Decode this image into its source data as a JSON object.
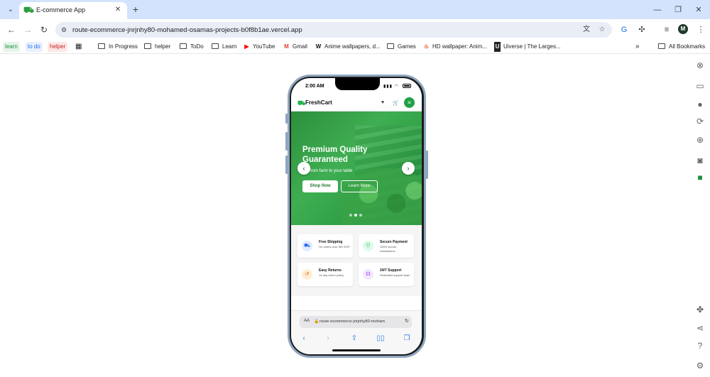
{
  "browser": {
    "tab": {
      "title": "E-commerce App",
      "icon": "freshcart-cart-icon"
    },
    "url": "route-ecommerce-jnrjnhy80-mohamed-osamas-projects-b0f8b1ae.vercel.app",
    "profile_initial": "M",
    "bookmarks": [
      {
        "label": "learn",
        "type": "badge",
        "color": "#1e8e3e",
        "bg": "#e6f4ea"
      },
      {
        "label": "to do",
        "type": "badge",
        "color": "#1a73e8",
        "bg": "#e8f0fe"
      },
      {
        "label": "helper",
        "type": "badge",
        "color": "#c5221f",
        "bg": "#fce8e6"
      },
      {
        "label": "In Progress",
        "type": "folder"
      },
      {
        "label": "helper",
        "type": "folder"
      },
      {
        "label": "ToDo",
        "type": "folder"
      },
      {
        "label": "Learn",
        "type": "folder"
      },
      {
        "label": "YouTube",
        "type": "site",
        "icon": "youtube-icon"
      },
      {
        "label": "Gmail",
        "type": "site",
        "icon": "gmail-icon"
      },
      {
        "label": "Anime wallpapers, d...",
        "type": "site",
        "icon": "wallhaven-icon"
      },
      {
        "label": "Games",
        "type": "folder"
      },
      {
        "label": "HD wallpaper: Anim...",
        "type": "site",
        "icon": "wallpaperflare-icon"
      },
      {
        "label": "Uiverse | The Larges...",
        "type": "site",
        "icon": "uiverse-icon"
      }
    ],
    "all_bookmarks": "All Bookmarks"
  },
  "phone": {
    "status": {
      "time": "2:00 AM"
    },
    "app": {
      "logo": "FreshCart",
      "hero": {
        "title": "Premium Quality Guaranteed",
        "subtitle": "...h from farm to your table",
        "shop_button": "Shop Now",
        "learn_button": "Learn More",
        "slides": 3,
        "active_slide": 2
      },
      "features": [
        {
          "title": "Free Shipping",
          "desc": "On orders over 500 EGP",
          "icon": "truck-icon",
          "color": "#2563eb",
          "bg": "#e0ecff"
        },
        {
          "title": "Secure Payment",
          "desc": "100% secure transactions",
          "icon": "shield-icon",
          "color": "#16a34a",
          "bg": "#dcfce7"
        },
        {
          "title": "Easy Returns",
          "desc": "14-day return policy",
          "icon": "return-icon",
          "color": "#ea580c",
          "bg": "#ffedd5"
        },
        {
          "title": "24/7 Support",
          "desc": "Dedicated support team",
          "icon": "headset-icon",
          "color": "#9333ea",
          "bg": "#f3e8ff"
        }
      ]
    },
    "safari": {
      "aa": "AA",
      "url": "route-ecommerce-jnrjnhy80-moham"
    }
  }
}
